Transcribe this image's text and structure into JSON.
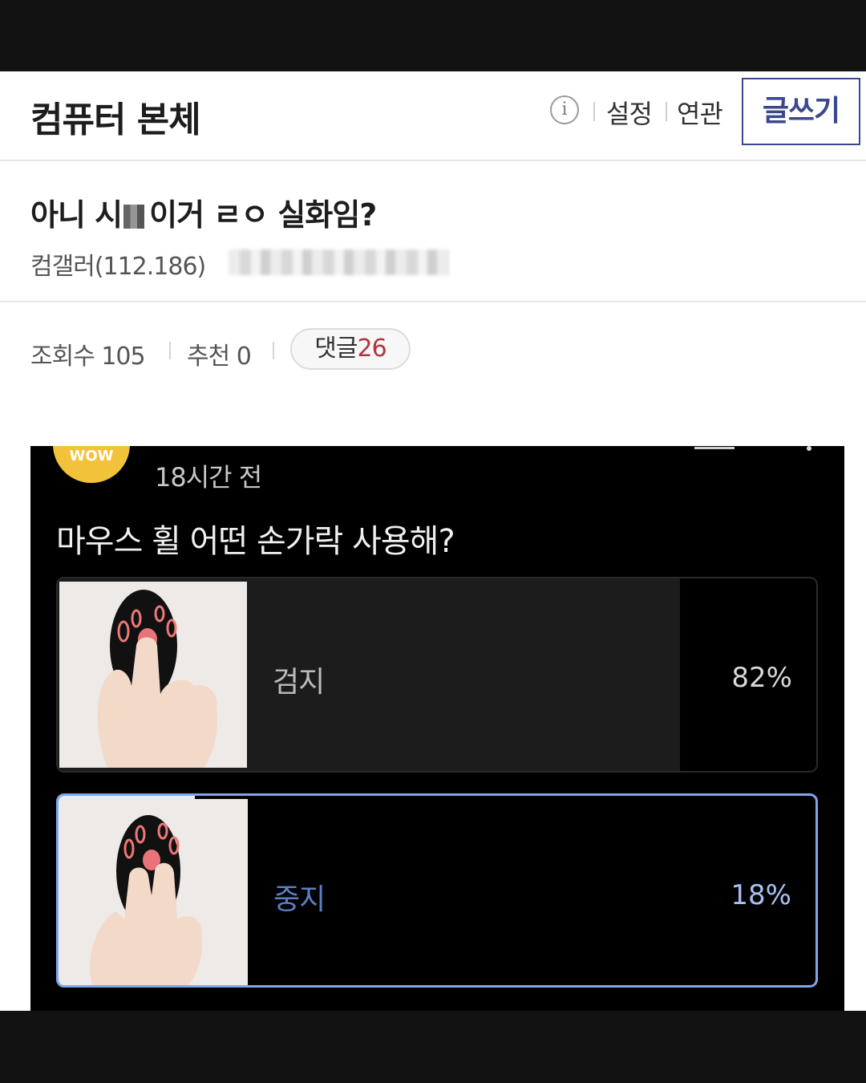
{
  "header": {
    "board_title": "컴퓨터 본체",
    "info_icon": "info-icon",
    "links": [
      "설정",
      "연관"
    ],
    "write_button": "글쓰기"
  },
  "post": {
    "title_prefix": "아니 시",
    "title_suffix": "이거 ㄹㅇ 실화임?",
    "author": "컴갤러(112.186)"
  },
  "stats": {
    "views_label": "조회수 105",
    "recommend_label": "추천 0",
    "comments_label": "댓글",
    "comments_count": "26"
  },
  "poll": {
    "time_ago": "18시간 전",
    "avatar_text": "WOW",
    "question": "마우스 휠 어떤 손가락 사용해?",
    "options": [
      {
        "label": "검지",
        "percent": "82%",
        "fraction": 0.82,
        "selected": false
      },
      {
        "label": "중지",
        "percent": "18%",
        "fraction": 0.18,
        "selected": true
      }
    ]
  },
  "colors": {
    "accent": "#3b4890",
    "comment_count": "#b0343c",
    "poll_selected_border": "#7fa6e8",
    "avatar": "#f2c23a"
  }
}
